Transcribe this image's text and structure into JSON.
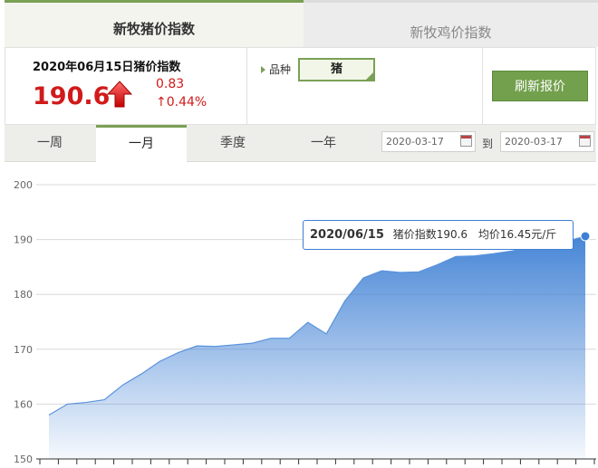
{
  "top_tabs": [
    {
      "label": "新牧猪价指数",
      "active": true
    },
    {
      "label": "新牧鸡价指数",
      "active": false
    }
  ],
  "summary": {
    "date_title": "2020年06月15日猪价指数",
    "price": "190.6",
    "change": "0.83",
    "change_pct": "↑0.44%",
    "trend_icon": "up-arrow-icon"
  },
  "breed": {
    "label": "品种",
    "selected": "猪"
  },
  "refresh_button": "刷新报价",
  "period_tabs": [
    {
      "label": "一周",
      "active": false
    },
    {
      "label": "一月",
      "active": true
    },
    {
      "label": "季度",
      "active": false
    },
    {
      "label": "一年",
      "active": false
    }
  ],
  "date_range": {
    "from": "2020-03-17",
    "to_label": "到",
    "to": "2020-03-17"
  },
  "tooltip": {
    "date": "2020/06/15",
    "index_text": "猪价指数190.6",
    "avg_text": "均价16.45元/斤"
  },
  "colors": {
    "accent_green": "#7aa054",
    "price_red": "#d11a1a",
    "series_blue": "#3d7fd4"
  },
  "chart_data": {
    "type": "area",
    "title": "",
    "xlabel": "",
    "ylabel": "",
    "ylim": [
      150,
      200
    ],
    "yticks": [
      150,
      160,
      170,
      180,
      190,
      200
    ],
    "grid": true,
    "series": [
      {
        "values": [
          158,
          160,
          160.3,
          160.8,
          163.5,
          165.5,
          167.8,
          169.4,
          170.6,
          170.5,
          170.8,
          171.1,
          172.0,
          172.0,
          174.9,
          172.8,
          178.8,
          183.0,
          184.3,
          184.0,
          184.1,
          185.4,
          186.9,
          187.0,
          187.4,
          187.9,
          188.5,
          189.3,
          189.7,
          190.6
        ]
      }
    ]
  }
}
